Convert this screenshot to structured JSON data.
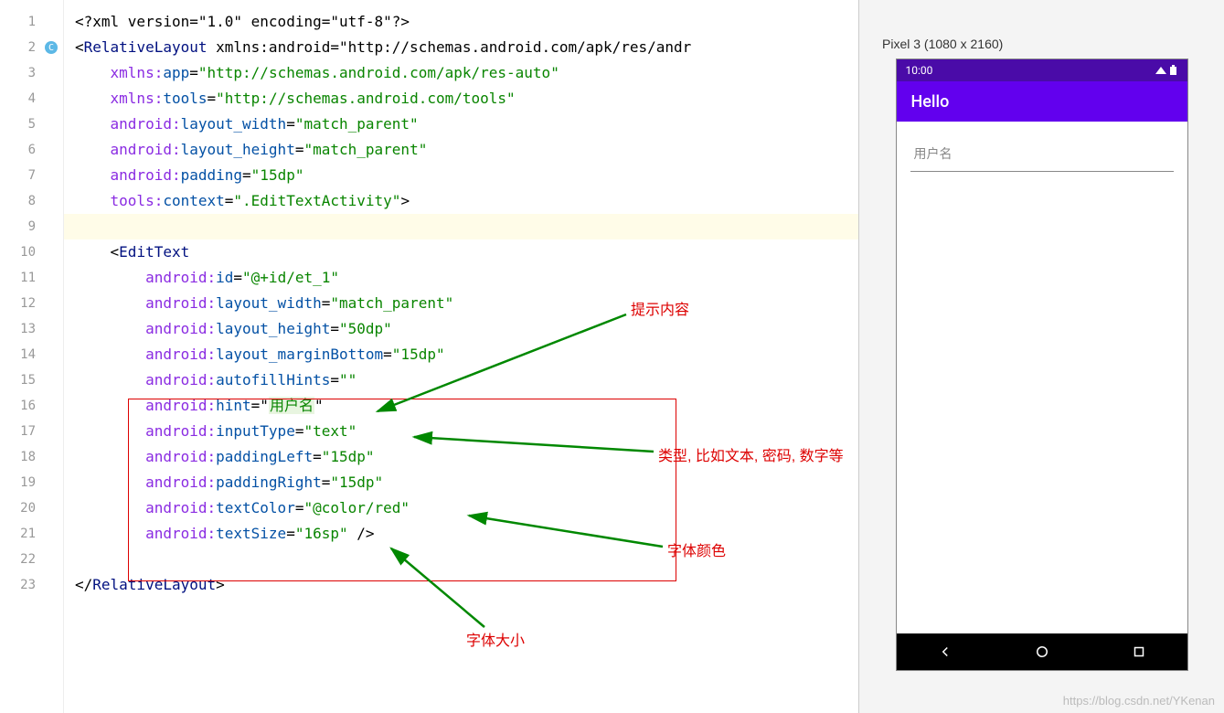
{
  "code": {
    "lines": [
      {
        "n": 1,
        "indent": 0,
        "raw": "<?xml version=\"1.0\" encoding=\"utf-8\"?>"
      },
      {
        "n": 2,
        "indent": 0,
        "raw": "<RelativeLayout xmlns:android=\"http://schemas.android.com/apk/res/andr"
      },
      {
        "n": 3,
        "indent": 1,
        "attr_ns": "xmlns",
        "attr_name": "app",
        "attr_value": "http://schemas.android.com/apk/res-auto"
      },
      {
        "n": 4,
        "indent": 1,
        "attr_ns": "xmlns",
        "attr_name": "tools",
        "attr_value": "http://schemas.android.com/tools"
      },
      {
        "n": 5,
        "indent": 1,
        "attr_ns": "android",
        "attr_name": "layout_width",
        "attr_value": "match_parent"
      },
      {
        "n": 6,
        "indent": 1,
        "attr_ns": "android",
        "attr_name": "layout_height",
        "attr_value": "match_parent"
      },
      {
        "n": 7,
        "indent": 1,
        "attr_ns": "android",
        "attr_name": "padding",
        "attr_value": "15dp"
      },
      {
        "n": 8,
        "indent": 1,
        "attr_ns": "tools",
        "attr_name": "context",
        "attr_value": ".EditTextActivity",
        "close": ">"
      },
      {
        "n": 9,
        "indent": 0,
        "raw": ""
      },
      {
        "n": 10,
        "indent": 1,
        "raw": "<EditText"
      },
      {
        "n": 11,
        "indent": 2,
        "attr_ns": "android",
        "attr_name": "id",
        "attr_value": "@+id/et_1"
      },
      {
        "n": 12,
        "indent": 2,
        "attr_ns": "android",
        "attr_name": "layout_width",
        "attr_value": "match_parent"
      },
      {
        "n": 13,
        "indent": 2,
        "attr_ns": "android",
        "attr_name": "layout_height",
        "attr_value": "50dp"
      },
      {
        "n": 14,
        "indent": 2,
        "attr_ns": "android",
        "attr_name": "layout_marginBottom",
        "attr_value": "15dp"
      },
      {
        "n": 15,
        "indent": 2,
        "attr_ns": "android",
        "attr_name": "autofillHints",
        "attr_value": ""
      },
      {
        "n": 16,
        "indent": 2,
        "attr_ns": "android",
        "attr_name": "hint",
        "attr_value": "用户名",
        "hint_hl": true
      },
      {
        "n": 17,
        "indent": 2,
        "attr_ns": "android",
        "attr_name": "inputType",
        "attr_value": "text"
      },
      {
        "n": 18,
        "indent": 2,
        "attr_ns": "android",
        "attr_name": "paddingLeft",
        "attr_value": "15dp"
      },
      {
        "n": 19,
        "indent": 2,
        "attr_ns": "android",
        "attr_name": "paddingRight",
        "attr_value": "15dp"
      },
      {
        "n": 20,
        "indent": 2,
        "attr_ns": "android",
        "attr_name": "textColor",
        "attr_value": "@color/red"
      },
      {
        "n": 21,
        "indent": 2,
        "attr_ns": "android",
        "attr_name": "textSize",
        "attr_value": "16sp",
        "close": " />"
      },
      {
        "n": 22,
        "indent": 0,
        "raw": ""
      },
      {
        "n": 23,
        "indent": 0,
        "raw": "</RelativeLayout>"
      }
    ]
  },
  "gutter": {
    "icons": {
      "2": "c-icon",
      "20": "red-square"
    }
  },
  "annotations": {
    "hint": "提示内容",
    "inputType": "类型, 比如文本, 密码, 数字等",
    "textColor": "字体颜色",
    "textSize": "字体大小"
  },
  "preview": {
    "device_label": "Pixel 3 (1080 x 2160)",
    "status_time": "10:00",
    "app_title": "Hello",
    "edit_hint": "用户名"
  },
  "watermark": "https://blog.csdn.net/YKenan"
}
